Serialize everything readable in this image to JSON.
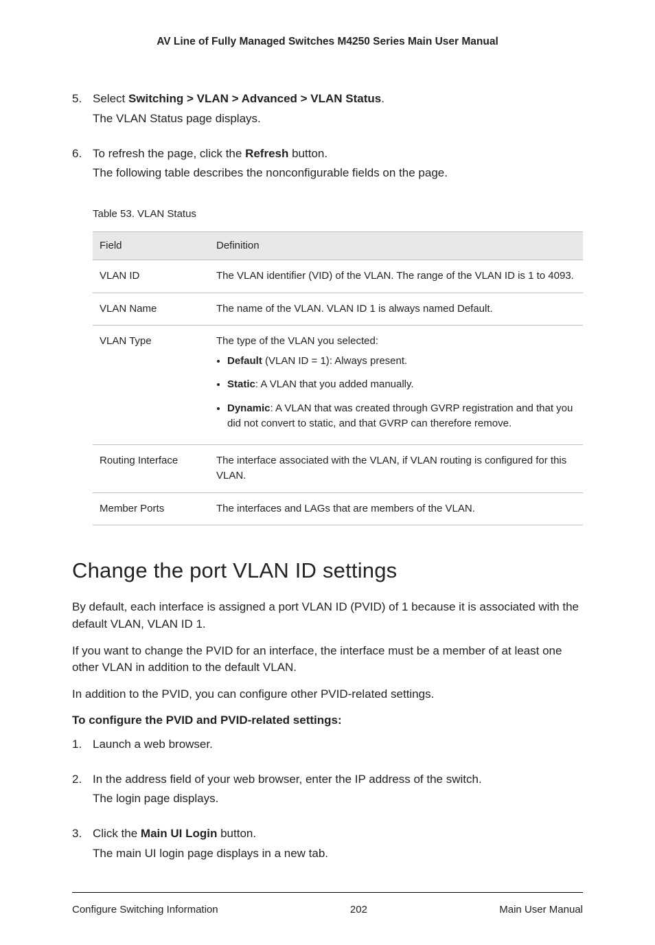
{
  "header": {
    "title": "AV Line of Fully Managed Switches M4250 Series Main User Manual"
  },
  "topList": {
    "item5": {
      "num": "5.",
      "prefix": "Select ",
      "bold": "Switching > VLAN > Advanced > VLAN Status",
      "suffix": ".",
      "line2": "The VLAN Status page displays."
    },
    "item6": {
      "num": "6.",
      "prefix": "To refresh the page, click the ",
      "bold": "Refresh",
      "suffix": " button.",
      "line2": "The following table describes the nonconfigurable fields on the page."
    }
  },
  "tableCaption": "Table 53. VLAN Status",
  "table": {
    "head": {
      "col1": "Field",
      "col2": "Definition"
    },
    "rows": {
      "r1": {
        "field": "VLAN ID",
        "def": "The VLAN identifier (VID) of the VLAN. The range of the VLAN ID is 1 to 4093."
      },
      "r2": {
        "field": "VLAN Name",
        "def": "The name of the VLAN. VLAN ID 1 is always named Default."
      },
      "r3": {
        "field": "VLAN Type",
        "intro": "The type of the VLAN you selected:",
        "b1": {
          "bold": "Default",
          "rest": " (VLAN ID = 1): Always present."
        },
        "b2": {
          "bold": "Static",
          "rest": ": A VLAN that you added manually."
        },
        "b3": {
          "bold": "Dynamic",
          "rest": ": A VLAN that was created through GVRP registration and that you did not convert to static, and that GVRP can therefore remove."
        }
      },
      "r4": {
        "field": "Routing Interface",
        "def": "The interface associated with the VLAN, if VLAN routing is configured for this VLAN."
      },
      "r5": {
        "field": "Member Ports",
        "def": "The interfaces and LAGs that are members of the VLAN."
      }
    }
  },
  "section": {
    "title": "Change the port VLAN ID settings",
    "p1": "By default, each interface is assigned a port VLAN ID (PVID) of 1 because it is associated with the default VLAN, VLAN ID 1.",
    "p2": "If you want to change the PVID for an interface, the interface must be a member of at least one other VLAN in addition to the default VLAN.",
    "p3": "In addition to the PVID, you can configure other PVID-related settings.",
    "leadIn": "To configure the PVID and PVID-related settings:",
    "steps": {
      "s1": {
        "num": "1.",
        "text": "Launch a web browser."
      },
      "s2": {
        "num": "2.",
        "text": "In the address field of your web browser, enter the IP address of the switch.",
        "line2": "The login page displays."
      },
      "s3": {
        "num": "3.",
        "prefix": "Click the ",
        "bold": "Main UI Login",
        "suffix": " button.",
        "line2": "The main UI login page displays in a new tab."
      }
    }
  },
  "footer": {
    "left": "Configure Switching Information",
    "center": "202",
    "right": "Main User Manual"
  }
}
